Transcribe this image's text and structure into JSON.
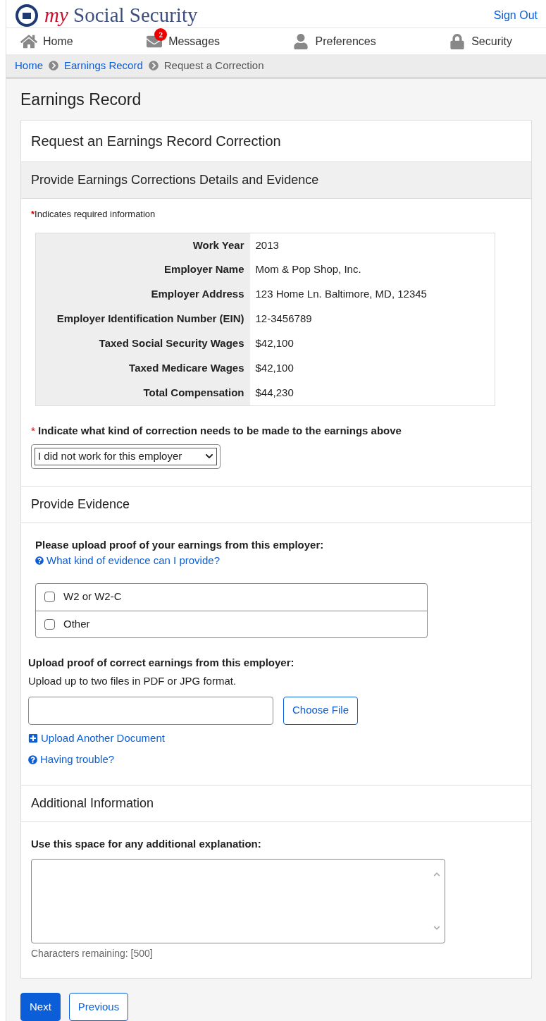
{
  "header": {
    "brand_prefix": "my",
    "brand_name": "Social Security",
    "sign_out": "Sign Out"
  },
  "nav": [
    {
      "kind": "home",
      "label": "Home"
    },
    {
      "kind": "messages",
      "label": "Messages",
      "badge": "2"
    },
    {
      "kind": "person",
      "label": "Preferences"
    },
    {
      "kind": "lock",
      "label": "Security"
    }
  ],
  "breadcrumb": [
    {
      "label": "Home",
      "link": true
    },
    {
      "label": "Earnings Record",
      "link": true
    },
    {
      "label": "Request a Correction",
      "link": false
    }
  ],
  "page_title": "Earnings Record",
  "card_title": "Request an Earnings Record Correction",
  "section_title": "Provide Earnings Corrections Details and Evidence",
  "required_mark": "*",
  "required_note": "Indicates required information",
  "details": [
    {
      "label": "Work Year",
      "value": "2013"
    },
    {
      "label": "Employer Name",
      "value": "Mom & Pop Shop, Inc."
    },
    {
      "label": "Employer Address",
      "value": "123 Home Ln. Baltimore, MD, 12345"
    },
    {
      "label": "Employer Identification Number (EIN)",
      "value": "12-3456789"
    },
    {
      "label": "Taxed Social Security Wages",
      "value": "$42,100"
    },
    {
      "label": "Taxed Medicare Wages",
      "value": "$42,100"
    },
    {
      "label": "Total Compensation",
      "value": "$44,230"
    }
  ],
  "correction": {
    "label": "Indicate what kind of correction needs to be made to the earnings above",
    "value": "I did not work for this employer"
  },
  "evidence": {
    "title": "Provide Evidence",
    "prompt": "Please upload proof of your earnings from this employer:",
    "help_link": "What kind of evidence can I provide?",
    "options": [
      {
        "label": "W2 or W2-C",
        "checked": false
      },
      {
        "label": "Other",
        "checked": false
      }
    ]
  },
  "upload": {
    "title": "Upload proof of correct earnings from this employer:",
    "hint": "Upload up to two files in PDF or JPG format.",
    "button": "Choose File",
    "add_link": "Upload Another Document",
    "trouble_link": "Having trouble?"
  },
  "additional": {
    "title": "Additional Information",
    "label": "Use this space for any additional explanation:",
    "counter": "Characters remaining: [500]"
  },
  "buttons": [
    {
      "label": "Next",
      "primary": true
    },
    {
      "label": "Previous",
      "primary": false
    }
  ]
}
